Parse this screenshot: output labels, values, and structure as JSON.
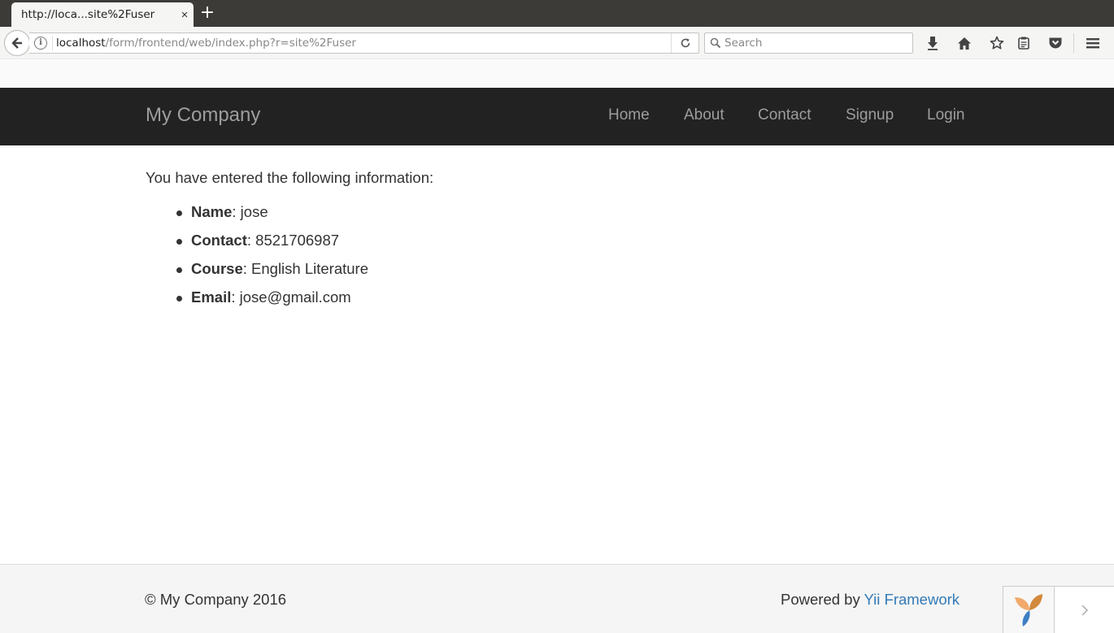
{
  "browser": {
    "tab_title": "http://loca...site%2Fuser",
    "tab_close": "×",
    "new_tab": "+",
    "url_host": "localhost",
    "url_path": "/form/frontend/web/index.php?r=site%2Fuser",
    "search_placeholder": "Search"
  },
  "navbar": {
    "brand": "My Company",
    "items": [
      {
        "label": "Home"
      },
      {
        "label": "About"
      },
      {
        "label": "Contact"
      },
      {
        "label": "Signup"
      },
      {
        "label": "Login"
      }
    ]
  },
  "main": {
    "intro": "You have entered the following information:",
    "fields": [
      {
        "label": "Name",
        "value": ": jose"
      },
      {
        "label": "Contact",
        "value": ": 8521706987"
      },
      {
        "label": "Course",
        "value": ": English Literature"
      },
      {
        "label": "Email",
        "value": ": jose@gmail.com"
      }
    ]
  },
  "footer": {
    "copyright": "© My Company 2016",
    "powered_prefix": "Powered by ",
    "powered_link": "Yii Framework"
  },
  "colors": {
    "navbar_bg": "#222222",
    "navbar_text": "#9d9d9d",
    "link": "#337ab7",
    "footer_bg": "#f5f5f5"
  }
}
